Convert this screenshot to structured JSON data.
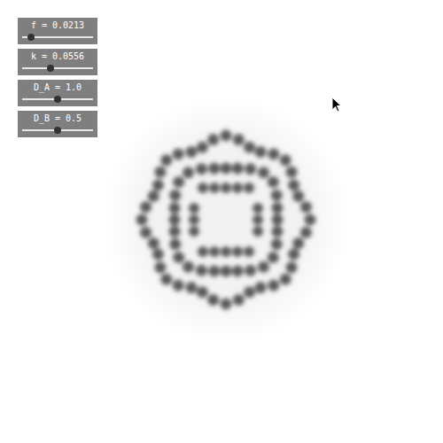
{
  "sliders": [
    {
      "label": "f = 0.0213",
      "level": 0.125
    },
    {
      "label": "k = 0.0556",
      "level": 0.4
    },
    {
      "label": "D_A = 1.0",
      "level": 0.5
    },
    {
      "label": "D_B = 0.5",
      "level": 0.5
    }
  ]
}
